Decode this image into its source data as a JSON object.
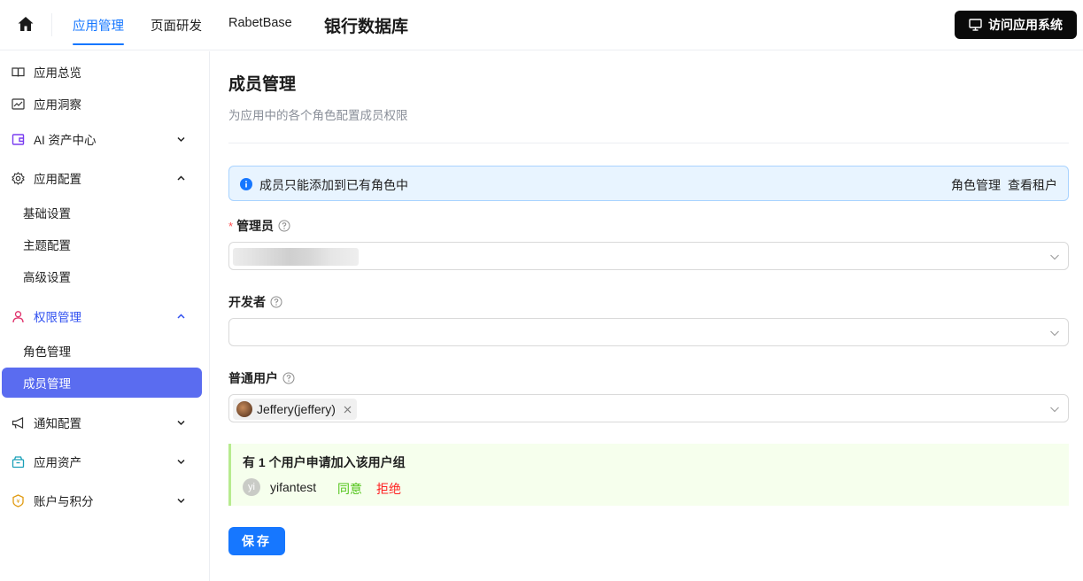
{
  "topbar": {
    "tabs": [
      {
        "label": "应用管理",
        "active": true
      },
      {
        "label": "页面研发",
        "active": false
      },
      {
        "label": "RabetBase",
        "active": false
      }
    ],
    "app_title": "银行数据库",
    "visit_button": "访问应用系统"
  },
  "sidebar": {
    "items": [
      {
        "label": "应用总览",
        "icon": "book-icon"
      },
      {
        "label": "应用洞察",
        "icon": "chart-icon"
      },
      {
        "label": "AI 资产中心",
        "icon": "wallet-icon",
        "expanded": false
      },
      {
        "label": "应用配置",
        "icon": "gear-icon",
        "expanded": true
      },
      {
        "label": "基础设置"
      },
      {
        "label": "主题配置"
      },
      {
        "label": "高级设置"
      },
      {
        "label": "权限管理",
        "icon": "user-icon",
        "expanded": true
      },
      {
        "label": "角色管理"
      },
      {
        "label": "成员管理",
        "active": true
      },
      {
        "label": "通知配置",
        "icon": "megaphone-icon",
        "expanded": false
      },
      {
        "label": "应用资产",
        "icon": "box-icon",
        "expanded": false
      },
      {
        "label": "账户与积分",
        "icon": "coin-icon",
        "expanded": false
      }
    ]
  },
  "main": {
    "title": "成员管理",
    "description": "为应用中的各个角色配置成员权限",
    "info": {
      "text": "成员只能添加到已有角色中",
      "link_roles": "角色管理",
      "link_tenants": "查看租户"
    },
    "fields": {
      "admin_label": "管理员",
      "admin_required": "*",
      "developer_label": "开发者",
      "user_label": "普通用户",
      "user_tag": "Jeffery(jeffery)"
    },
    "request": {
      "title": "有 1 个用户申请加入该用户组",
      "avatar_text": "yi",
      "username": "yifantest",
      "accept": "同意",
      "reject": "拒绝"
    },
    "save": "保存"
  },
  "colors": {
    "primary": "#1677ff",
    "sidebar_active": "#5a6cf0",
    "accept": "#52c41a",
    "reject": "#ff1f1f"
  }
}
